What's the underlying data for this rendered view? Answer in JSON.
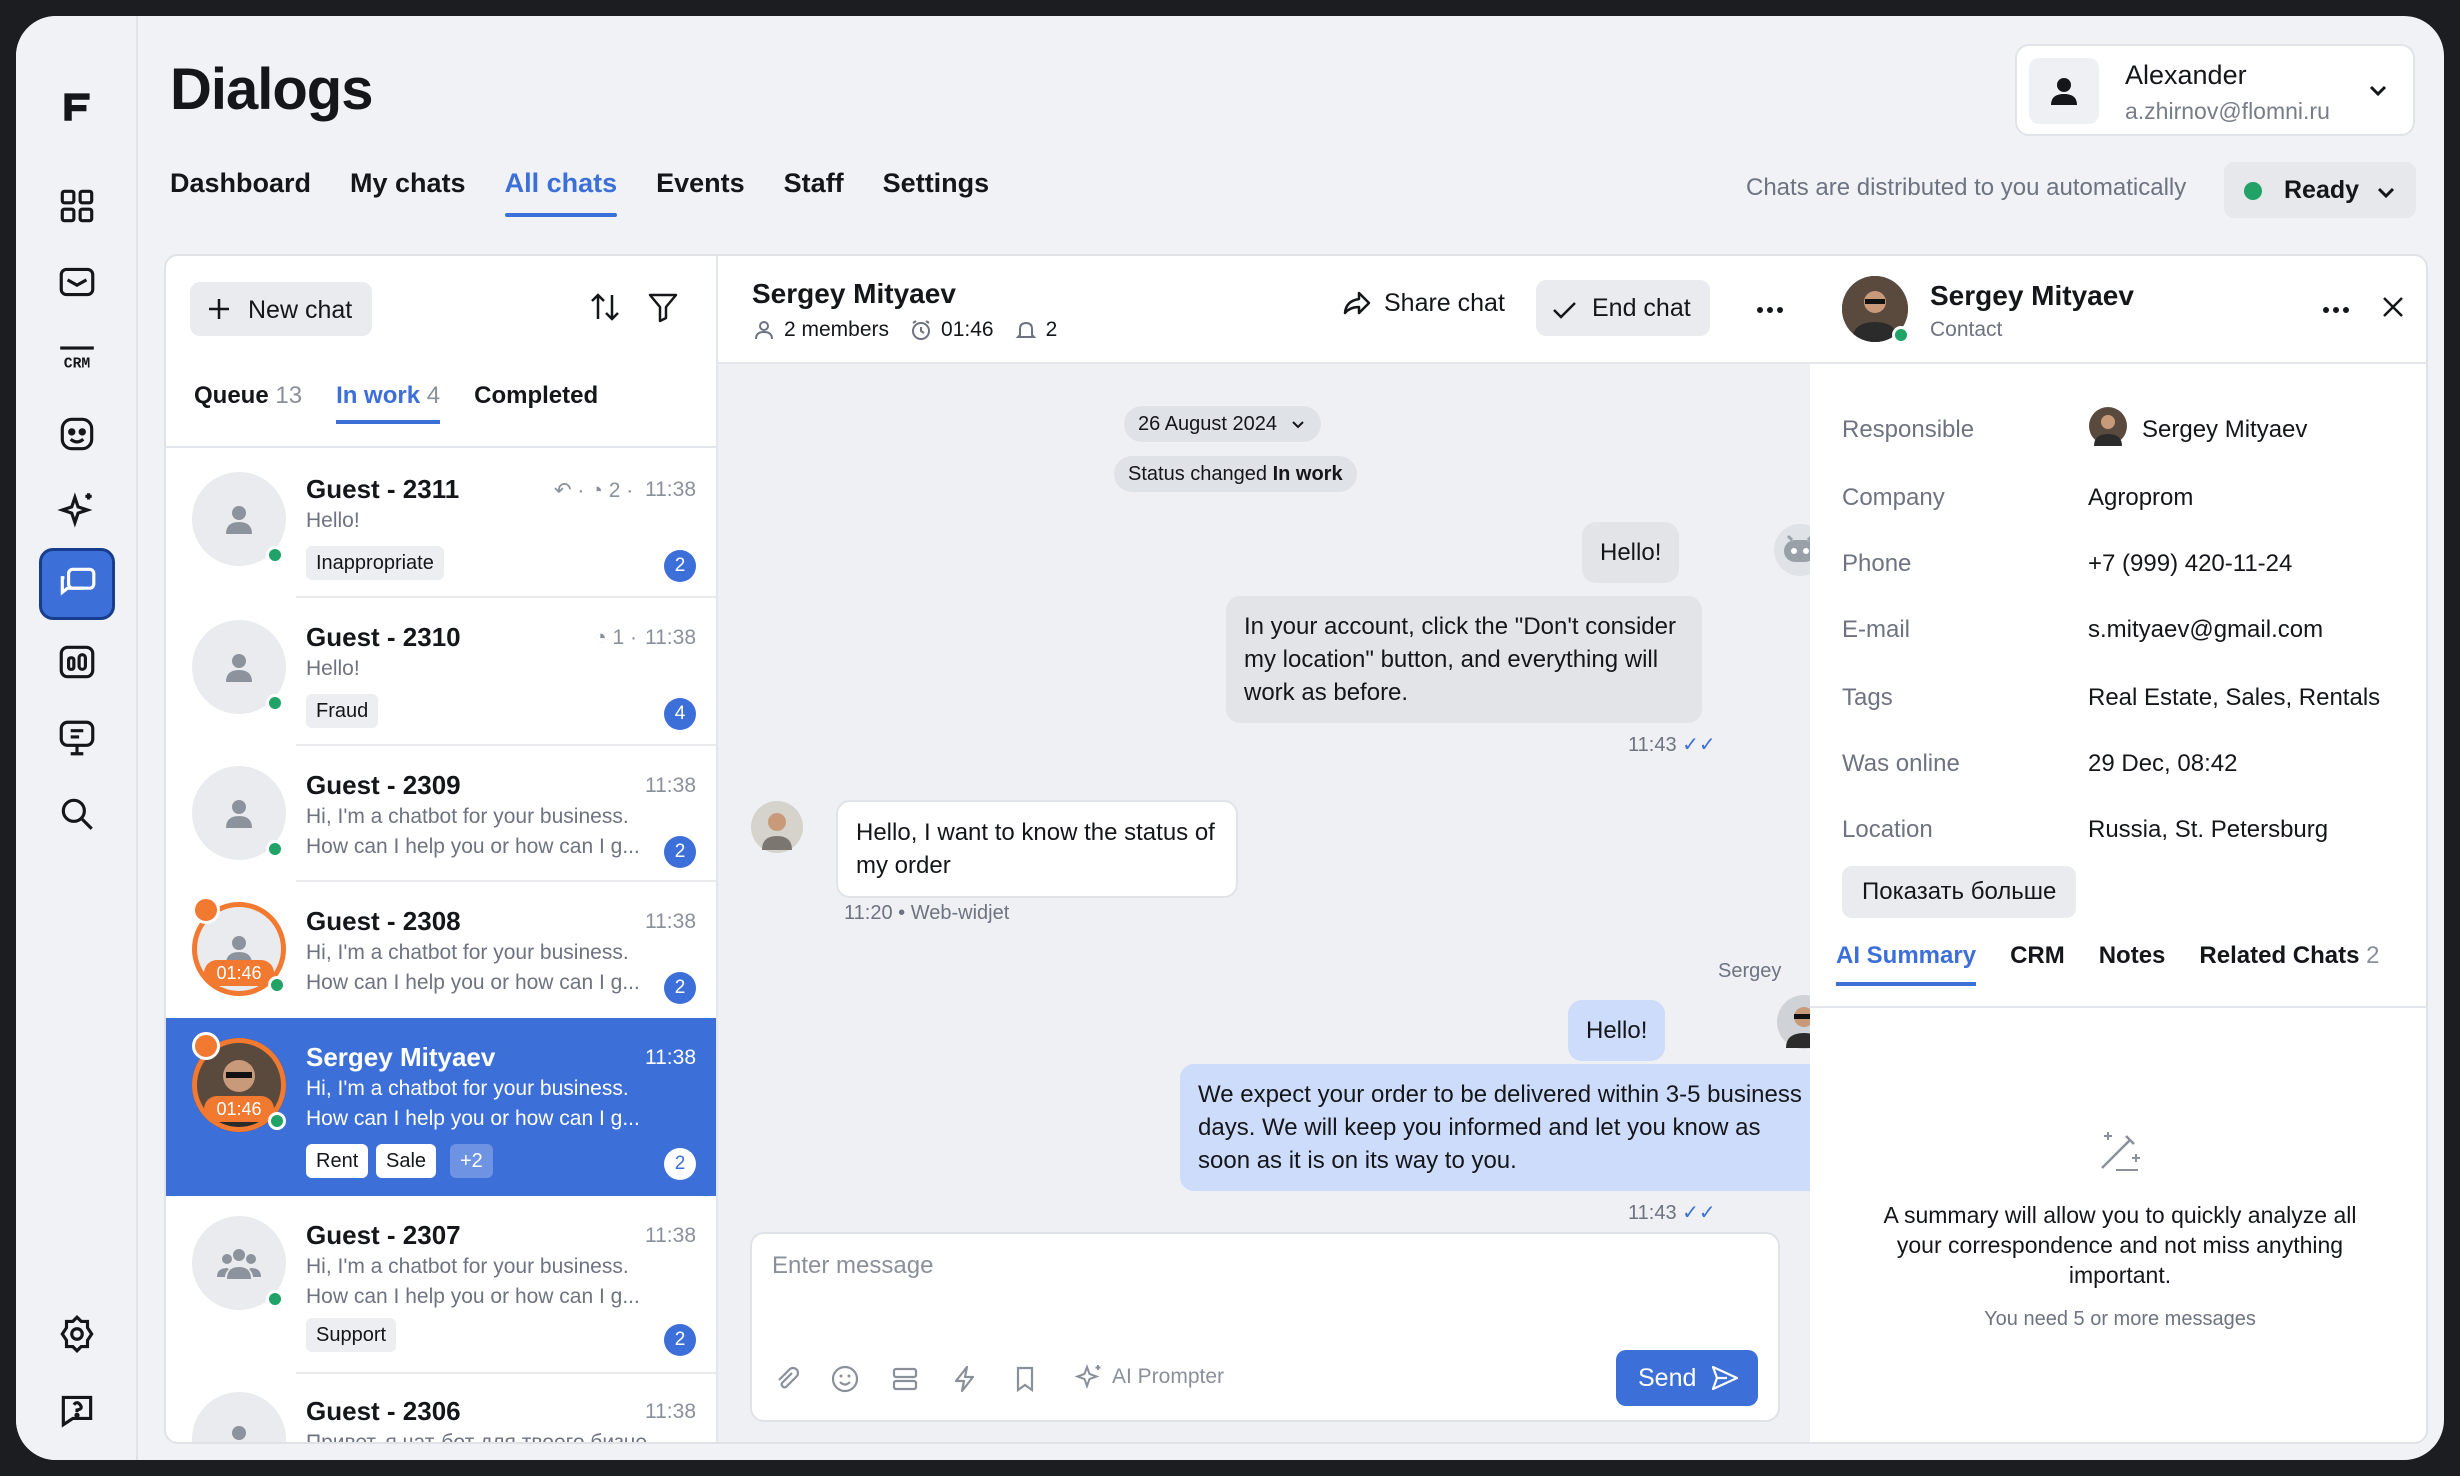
{
  "page_title": "Dialogs",
  "nav_tabs": [
    "Dashboard",
    "My chats",
    "All chats",
    "Events",
    "Staff",
    "Settings"
  ],
  "active_nav": "All chats",
  "user": {
    "name": "Alexander",
    "email": "a.zhirnov@flomni.ru"
  },
  "distribution_text": "Chats are distributed to you automatically",
  "status": {
    "label": "Ready",
    "color": "#21a266"
  },
  "rail_icons": [
    "logo-icon",
    "dashboard-icon",
    "mail-icon",
    "crm-icon",
    "bot-icon",
    "sparkle-icon",
    "dialogs-icon",
    "analytics-icon",
    "knowledge-icon",
    "search-icon",
    "settings-icon",
    "help-icon"
  ],
  "colors": {
    "accent": "#3c6fd8",
    "online": "#21a266",
    "timer": "#f27930"
  },
  "list": {
    "new_chat": "New chat",
    "tabs": [
      {
        "label": "Queue",
        "count": "13"
      },
      {
        "label": "In work",
        "count": "4"
      },
      {
        "label": "Completed",
        "count": ""
      }
    ],
    "chats": [
      {
        "name": "Guest - 2311",
        "time": "11:38",
        "meta": "↶ · ◔ 2 ·",
        "preview": [
          "Hello!"
        ],
        "tags": [
          "Inappropriate"
        ],
        "badge": "2"
      },
      {
        "name": "Guest - 2310",
        "time": "11:38",
        "meta": "◔ 1 ·",
        "preview": [
          "Hello!"
        ],
        "tags": [
          "Fraud"
        ],
        "badge": "4"
      },
      {
        "name": "Guest - 2309",
        "time": "11:38",
        "preview": [
          "Hi, I'm a chatbot for your business.",
          "How can I help you or how can I g..."
        ],
        "tags": [],
        "badge": "2"
      },
      {
        "name": "Guest - 2308",
        "time": "11:38",
        "timer": "01:46",
        "preview": [
          "Hi, I'm a chatbot for your business.",
          "How can I help you or how can I g..."
        ],
        "tags": [],
        "badge": "2"
      },
      {
        "name": "Sergey Mityaev",
        "time": "11:38",
        "timer": "01:46",
        "preview": [
          "Hi, I'm a chatbot for your business.",
          "How can I help you or how can I g..."
        ],
        "tags": [
          "Rent",
          "Sale",
          "+2"
        ],
        "badge": "2"
      },
      {
        "name": "Guest - 2307",
        "time": "11:38",
        "preview": [
          "Hi, I'm a chatbot for your business.",
          "How can I help you or how can I g..."
        ],
        "tags": [
          "Support"
        ],
        "badge": "2"
      },
      {
        "name": "Guest - 2306",
        "time": "11:38",
        "preview": [
          "Привет, я чат-бот для твоего бизнеса."
        ],
        "tags": [],
        "badge": ""
      }
    ]
  },
  "conversation": {
    "name": "Sergey Mityaev",
    "members": "2 members",
    "timer": "01:46",
    "notif": "2",
    "share": "Share chat",
    "end": "End chat",
    "date_pill": "26 August 2024",
    "status_changed": "Status changed",
    "status_value": "In work",
    "messages": {
      "bot1": "Hello!",
      "bot2": "In your account, click the \"Don't consider my location\" button, and everything will work as before.",
      "bot_time": "11:43",
      "guest": "Hello, I want to know the status of my order",
      "guest_time": "11:20",
      "guest_source": "Web-widjet",
      "op_name": "Sergey",
      "op1": "Hello!",
      "op2": "We expect your order to be delivered within 3-5 business days. We will keep you informed and let you know as soon as it is on its way to you.",
      "op_time": "11:43"
    },
    "composer_placeholder": "Enter message",
    "ai_prompter": "AI Prompter",
    "send": "Send"
  },
  "profile": {
    "name": "Sergey Mityaev",
    "role": "Contact",
    "fields": [
      {
        "label": "Responsible",
        "value": "Sergey Mityaev"
      },
      {
        "label": "Company",
        "value": "Agroprom"
      },
      {
        "label": "Phone",
        "value": "+7 (999) 420-11-24"
      },
      {
        "label": "E-mail",
        "value": "s.mityaev@gmail.com"
      },
      {
        "label": "Tags",
        "value": "Real Estate, Sales, Rentals"
      },
      {
        "label": "Was online",
        "value": "29 Dec, 08:42"
      },
      {
        "label": "Location",
        "value": "Russia, St. Petersburg"
      }
    ],
    "show_more": "Показать больше",
    "tabs": [
      {
        "label": "AI Summary",
        "count": ""
      },
      {
        "label": "CRM",
        "count": ""
      },
      {
        "label": "Notes",
        "count": ""
      },
      {
        "label": "Related Chats",
        "count": "2"
      }
    ],
    "summary_text": "A summary will allow you to quickly analyze all your correspondence and not miss anything important.",
    "summary_note": "You need 5 or more messages"
  }
}
